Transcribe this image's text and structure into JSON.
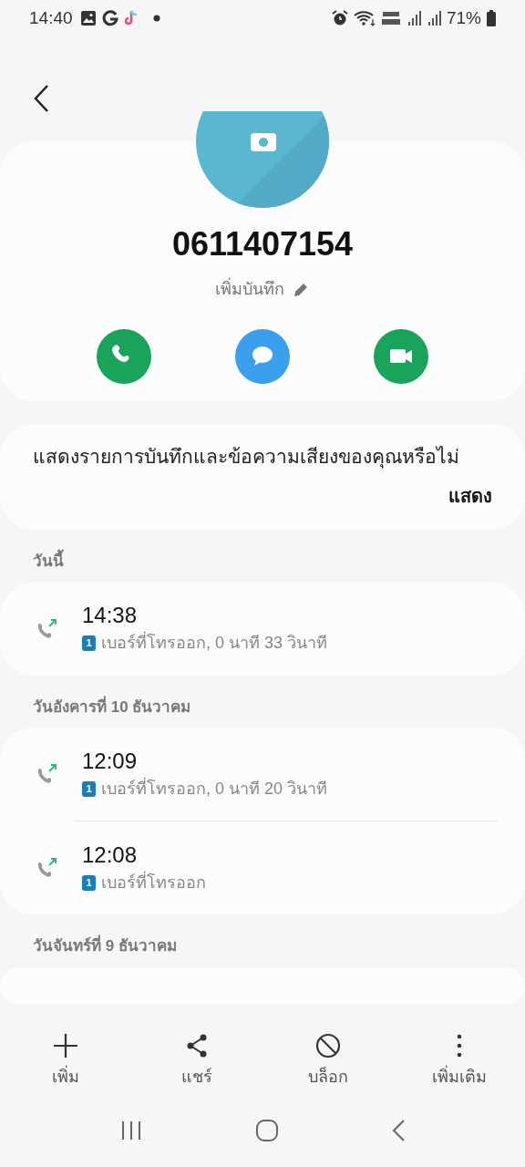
{
  "status_bar": {
    "time": "14:40",
    "battery": "71%"
  },
  "contact": {
    "number": "0611407154",
    "note": "เพิ่มบันทึก"
  },
  "actions": [
    {
      "kind": "call"
    },
    {
      "kind": "message"
    },
    {
      "kind": "video"
    }
  ],
  "recording_prompt": {
    "text": "แสดงรายการบันทึกและข้อความเสียงของคุณหรือไม่",
    "button": "แสดง"
  },
  "call_groups": [
    {
      "date": "วันนี้",
      "calls": [
        {
          "time": "14:38",
          "sim": "1",
          "detail": "เบอร์ที่โทรออก, 0 นาที 33 วินาที"
        }
      ]
    },
    {
      "date": "วันอังคารที่ 10 ธันวาคม",
      "calls": [
        {
          "time": "12:09",
          "sim": "1",
          "detail": "เบอร์ที่โทรออก, 0 นาที 20 วินาที"
        },
        {
          "time": "12:08",
          "sim": "1",
          "detail": "เบอร์ที่โทรออก"
        }
      ]
    },
    {
      "date": "วันจันทร์ที่ 9 ธันวาคม"
    }
  ],
  "bottom_bar": [
    {
      "kind": "add",
      "label": "เพิ่ม"
    },
    {
      "kind": "share",
      "label": "แชร์"
    },
    {
      "kind": "block",
      "label": "บล็อก"
    },
    {
      "kind": "more",
      "label": "เพิ่มเติม"
    }
  ]
}
